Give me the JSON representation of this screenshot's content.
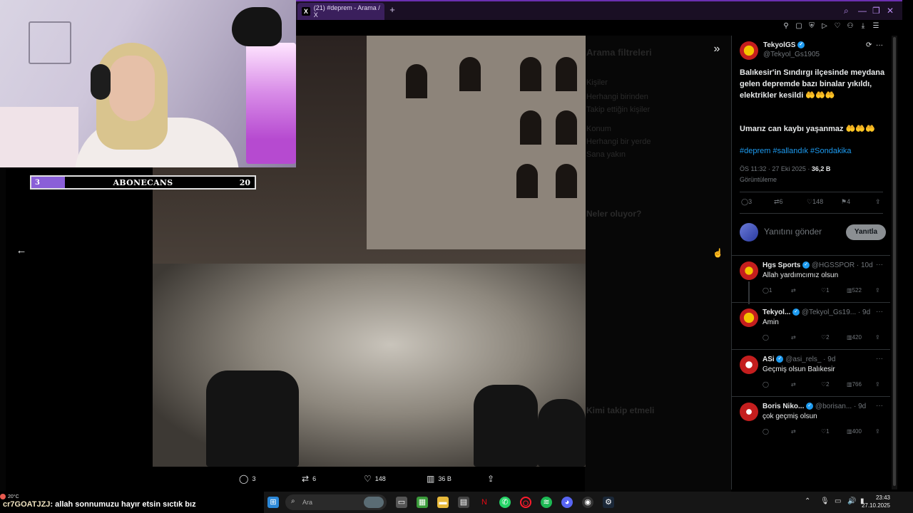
{
  "browser": {
    "tab_title": "(21) #deprem - Arama / X",
    "tab_logo": "X",
    "new_tab": "+"
  },
  "overlay": {
    "sub_goal_title": "ABONECANS",
    "sub_current": "3",
    "sub_target": "20",
    "sub_progress": 0.15
  },
  "tweet": {
    "author_name": "TekyolGS",
    "author_handle": "@Tekyol_Gs1905",
    "text_main": "Balıkesir'in Sındırgı ilçesinde meydana gelen depremde bazı binalar yıkıldı, elektrikler kesildi 🤲🤲🤲",
    "text_second": "Umarız can kaybı yaşanmaz 🤲🤲🤲",
    "hashtags": "#deprem #sallandık #Sondakika",
    "timestamp": "ÖS 11:32 · 27 Eki 2025 · ",
    "views_count": "36,2 B",
    "views_label": "Görüntüleme",
    "replies": "3",
    "reposts": "6",
    "likes": "148",
    "bookmarks": "4",
    "reply_placeholder": "Yanıtını gönder",
    "reply_button": "Yanıtla"
  },
  "media_actions": {
    "replies": "3",
    "reposts": "6",
    "likes": "148",
    "views": "36 B"
  },
  "replies": [
    {
      "name": "Hgs Sports",
      "handle": "@HGSSPOR · 10d",
      "text": "Allah yardımcımız olsun",
      "r": "1",
      "rt": "",
      "l": "1",
      "v": "522"
    },
    {
      "name": "Tekyol...",
      "handle": "@Tekyol_Gs19... · 9d",
      "text": "Amin",
      "r": "",
      "rt": "",
      "l": "2",
      "v": "420"
    },
    {
      "name": "ASi",
      "handle": "@asi_rels_ · 9d",
      "text": "Geçmiş olsun Balıkesir",
      "r": "",
      "rt": "",
      "l": "2",
      "v": "766"
    },
    {
      "name": "Boris Niko...",
      "handle": "@borisan... · 9d",
      "text": "çok geçmiş olsun",
      "r": "",
      "rt": "",
      "l": "1",
      "v": "400"
    }
  ],
  "background_page": {
    "filters_title": "Arama filtreleri",
    "people": "Kişiler",
    "anyone": "Herhangi birinden",
    "following": "Takip ettiğin kişiler",
    "location": "Konum",
    "anywhere": "Herhangi bir yerde",
    "near_you": "Sana yakın",
    "whats_happening": "Neler oluyor?",
    "who_to_follow": "Kimi takip etmeli"
  },
  "chat": {
    "weather": "20°C",
    "username": "cr7GOATJZJ",
    "message": ": allah sonnumuzu hayır etsin sıctık bız"
  },
  "taskbar": {
    "search_placeholder": "Ara",
    "time": "23:43",
    "date": "27.10.2025"
  },
  "icons": {
    "back": "arrow-left-icon",
    "expand": "chevron-double-right-icon",
    "verified": "verified-badge-icon"
  }
}
